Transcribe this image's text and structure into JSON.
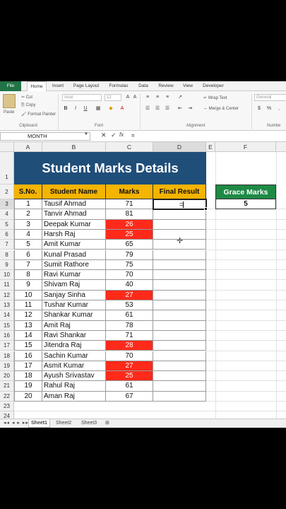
{
  "ribbon_tabs": [
    "File",
    "Home",
    "Insert",
    "Page Layout",
    "Formulas",
    "Data",
    "Review",
    "View",
    "Developer"
  ],
  "clipboard": {
    "cut": "Cut",
    "copy": "Copy",
    "paste": "Paste",
    "format_painter": "Format Painter",
    "group": "Clipboard"
  },
  "font": {
    "name": "Arial",
    "size": "12",
    "group": "Font"
  },
  "alignment": {
    "wrap_text": "Wrap Text",
    "merge_center": "Merge & Center",
    "group": "Alignment"
  },
  "number": {
    "format": "General",
    "group": "Numbe"
  },
  "formula_bar": {
    "name_box": "MONTH",
    "fx": "fx",
    "formula": "="
  },
  "columns": [
    "A",
    "B",
    "C",
    "D",
    "E",
    "F"
  ],
  "title": "Student Marks Details",
  "headers": {
    "sno": "S.No.",
    "name": "Student Name",
    "marks": "Marks",
    "final": "Final Result",
    "grace": "Grace Marks"
  },
  "grace_value": "5",
  "editing_cell_value": "=",
  "students": [
    {
      "sno": "1",
      "name": "Tausif Ahmad",
      "marks": "71",
      "fail": false
    },
    {
      "sno": "2",
      "name": "Tanvir Ahmad",
      "marks": "81",
      "fail": false
    },
    {
      "sno": "3",
      "name": "Deepak Kumar",
      "marks": "26",
      "fail": true
    },
    {
      "sno": "4",
      "name": "Harsh Raj",
      "marks": "25",
      "fail": true
    },
    {
      "sno": "5",
      "name": "Amit Kumar",
      "marks": "65",
      "fail": false
    },
    {
      "sno": "6",
      "name": "Kunal Prasad",
      "marks": "79",
      "fail": false
    },
    {
      "sno": "7",
      "name": "Sumit Rathore",
      "marks": "75",
      "fail": false
    },
    {
      "sno": "8",
      "name": "Ravi Kumar",
      "marks": "70",
      "fail": false
    },
    {
      "sno": "9",
      "name": "Shivam Raj",
      "marks": "40",
      "fail": false
    },
    {
      "sno": "10",
      "name": "Sanjay Sinha",
      "marks": "27",
      "fail": true
    },
    {
      "sno": "11",
      "name": "Tushar Kumar",
      "marks": "53",
      "fail": false
    },
    {
      "sno": "12",
      "name": "Shankar Kumar",
      "marks": "61",
      "fail": false
    },
    {
      "sno": "13",
      "name": "Amit Raj",
      "marks": "78",
      "fail": false
    },
    {
      "sno": "14",
      "name": "Ravi Shankar",
      "marks": "71",
      "fail": false
    },
    {
      "sno": "15",
      "name": "Jitendra Raj",
      "marks": "28",
      "fail": true
    },
    {
      "sno": "16",
      "name": "Sachin Kumar",
      "marks": "70",
      "fail": false
    },
    {
      "sno": "17",
      "name": "Asmit Kumar",
      "marks": "27",
      "fail": true
    },
    {
      "sno": "18",
      "name": "Ayush Srivastav",
      "marks": "25",
      "fail": true
    },
    {
      "sno": "19",
      "name": "Rahul Raj",
      "marks": "61",
      "fail": false
    },
    {
      "sno": "20",
      "name": "Aman Raj",
      "marks": "67",
      "fail": false
    }
  ],
  "row_numbers": [
    "1",
    "2",
    "3",
    "4",
    "5",
    "6",
    "7",
    "8",
    "9",
    "10",
    "11",
    "12",
    "13",
    "14",
    "15",
    "16",
    "17",
    "18",
    "19",
    "20",
    "21",
    "22",
    "23",
    "24"
  ],
  "sheet_tabs": [
    "Sheet1",
    "Sheet2",
    "Sheet3"
  ],
  "colors": {
    "title_bg": "#1f4e79",
    "header_bg": "#f4b400",
    "grace_bg": "#1e8a45",
    "fail_bg": "#ff2a1a",
    "excel_green": "#217346"
  }
}
